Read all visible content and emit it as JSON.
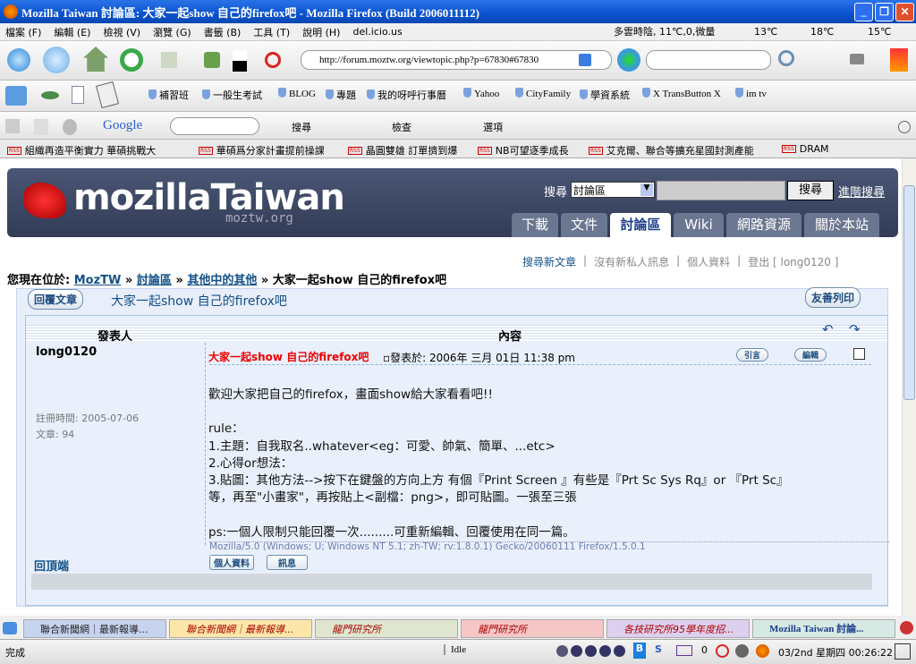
{
  "window": {
    "title": "Mozilla Taiwan 討論區: 大家一起show 自己的firefox吧 - Mozilla Firefox (Build 2006011112)"
  },
  "menu": [
    "檔案 (F)",
    "編輯 (E)",
    "檢視 (V)",
    "瀏覽 (G)",
    "書籤 (B)",
    "工具 (T)",
    "說明 (H)",
    "del.icio.us"
  ],
  "weather": {
    "current": "多雲時陰, 11℃,0,微量",
    "d1": "13℃",
    "d2": "18℃",
    "d3": "15℃"
  },
  "nav": {
    "url": "http://forum.moztw.org/viewtopic.php?p=67830#67830"
  },
  "bookmarks": [
    "補習班",
    "一般生考試",
    "BLOG",
    "專題",
    "我的呀呼行事曆",
    "Yahoo",
    "CityFamily",
    "學資系統",
    "X TransButton X",
    "im tv"
  ],
  "google": {
    "logo": "Google",
    "search": "搜尋",
    "check": "檢查",
    "options": "選項"
  },
  "news": [
    "組織再造平衡實力 華碩挑戰大",
    "華碩爲分家計畫提前操課",
    "晶圓雙雄 訂單擠到爆",
    "NB可望逐季成長",
    "艾克爾、聯合等擴充星國封測產能",
    "DRAM"
  ],
  "site": {
    "logo": "mozillaTaiwan",
    "domain": "moztw.org",
    "search_label": "搜尋",
    "search_scope": "討論區",
    "search_button": "搜尋",
    "advanced": "進階搜尋",
    "tabs": [
      "下載",
      "文件",
      "討論區",
      "Wiki",
      "網路資源",
      "關於本站"
    ],
    "active_tab": 2
  },
  "userlinks": {
    "search_new": "搜尋新文章",
    "no_pm": "沒有新私人訊息",
    "profile": "個人資料",
    "logout": "登出 [ long0120 ]"
  },
  "breadcrumb": {
    "prefix": "您現在位於:",
    "items": [
      "MozTW",
      "討論區",
      "其他中的其他"
    ],
    "current": "大家一起show 自己的firefox吧"
  },
  "topic": {
    "reply_button": "回覆文章",
    "title": "大家一起show 自己的firefox吧",
    "print_button": "友善列印"
  },
  "table": {
    "col_author": "發表人",
    "col_content": "內容"
  },
  "post": {
    "author": "long0120",
    "registered": "註冊時間: 2005-07-06",
    "posts": "文章: 94",
    "subject": "大家一起show 自己的firefox吧",
    "posted": "發表於: 2006年 三月 01日 11:38 pm",
    "quote": "引言",
    "edit": "編輯",
    "lines": [
      "歡迎大家把自己的firefox，畫面show給大家看看吧!!",
      "",
      "rule：",
      "1.主題：自我取名..whatever<eg：可愛、帥氣、簡單、...etc>",
      "2.心得or想法：",
      "3.貼圖：其他方法-->按下在鍵盤的方向上方 有個『Print Screen 』有些是『Prt Sc Sys Rq』or 『Prt Sc』",
      "等，再至\"小畫家\"，再按貼上<副檔：png>，即可貼圖。一張至三張",
      "",
      "ps:一個人限制只能回覆一次.........可重新編輯、回覆使用在同一篇。"
    ],
    "signature": "Mozilla/5.0 (Windows; U; Windows NT 5.1; zh-TW; rv:1.8.0.1) Gecko/20060111 Firefox/1.5.0.1",
    "back_top": "回頂端",
    "profile_btn": "個人資料",
    "pm_btn": "訊息"
  },
  "tabs": [
    "聯合新聞網｜最新報導...",
    "聯合新聞網｜最新報導...",
    "龍門研究所",
    "龍門研究所",
    "各技研究所95學年度招...",
    "Mozilla Taiwan 討論..."
  ],
  "status": {
    "text": "完成",
    "media": "Idle",
    "mail_count": "0",
    "clock": "03/2nd 星期四 00:26:22"
  }
}
